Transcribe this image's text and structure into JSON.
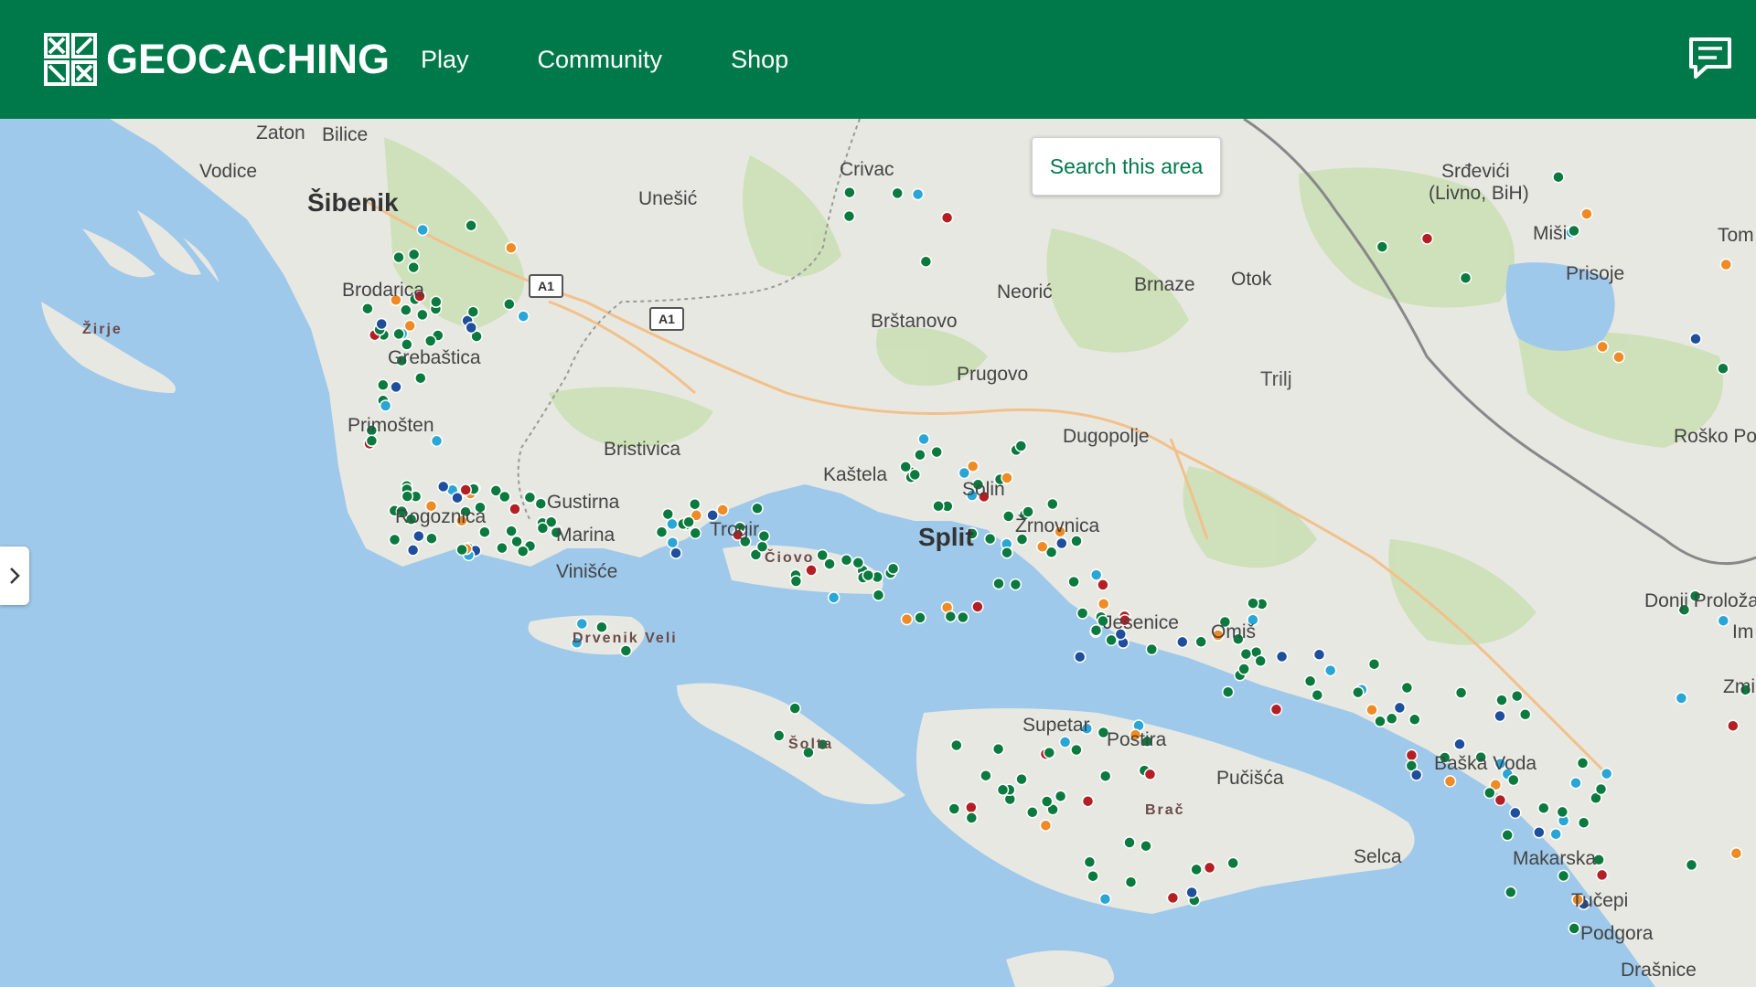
{
  "header": {
    "brand": "GEOCACHING",
    "nav": [
      "Play",
      "Community",
      "Shop"
    ]
  },
  "map": {
    "search_button": "Search this area",
    "road_shields": [
      "A1",
      "A1"
    ],
    "labels": [
      "Zaton",
      "Bilice",
      "Vodice",
      "Šibenik",
      "Unešić",
      "Crivac",
      "Srđevići",
      "(Livno, BiH)",
      "Miši",
      "Tom",
      "Žirje",
      "Brodarica",
      "Grebaštica",
      "Primošten",
      "Rogoznica",
      "Bristivica",
      "Gustirna",
      "Marina",
      "Vinišće",
      "Drvenik Veli",
      "Trogir",
      "Čiovo",
      "Kaštela",
      "Solin",
      "Split",
      "Žrnovnica",
      "Dugopolje",
      "Brštanovo",
      "Prugovo",
      "Neorić",
      "Brnaze",
      "Otok",
      "Trilj",
      "Prisoje",
      "Roško Polje",
      "Donji Proložac",
      "Jesenice",
      "Omiš",
      "Šolta",
      "Supetar",
      "Postira",
      "Brač",
      "Pučišća",
      "Selca",
      "Baška Voda",
      "Makarska",
      "Tučepi",
      "Podgora",
      "Drašnice",
      "Zmi",
      "Im"
    ]
  },
  "colors": {
    "brand_green": "#00794a",
    "water": "#9ec9ea",
    "land": "#e8e8e2",
    "cache_traditional": "#0a7a3e",
    "cache_mystery": "#1e4e9c",
    "cache_multi": "#f08a24",
    "cache_event": "#b31f24",
    "cache_virtual": "#2aa6d6"
  }
}
